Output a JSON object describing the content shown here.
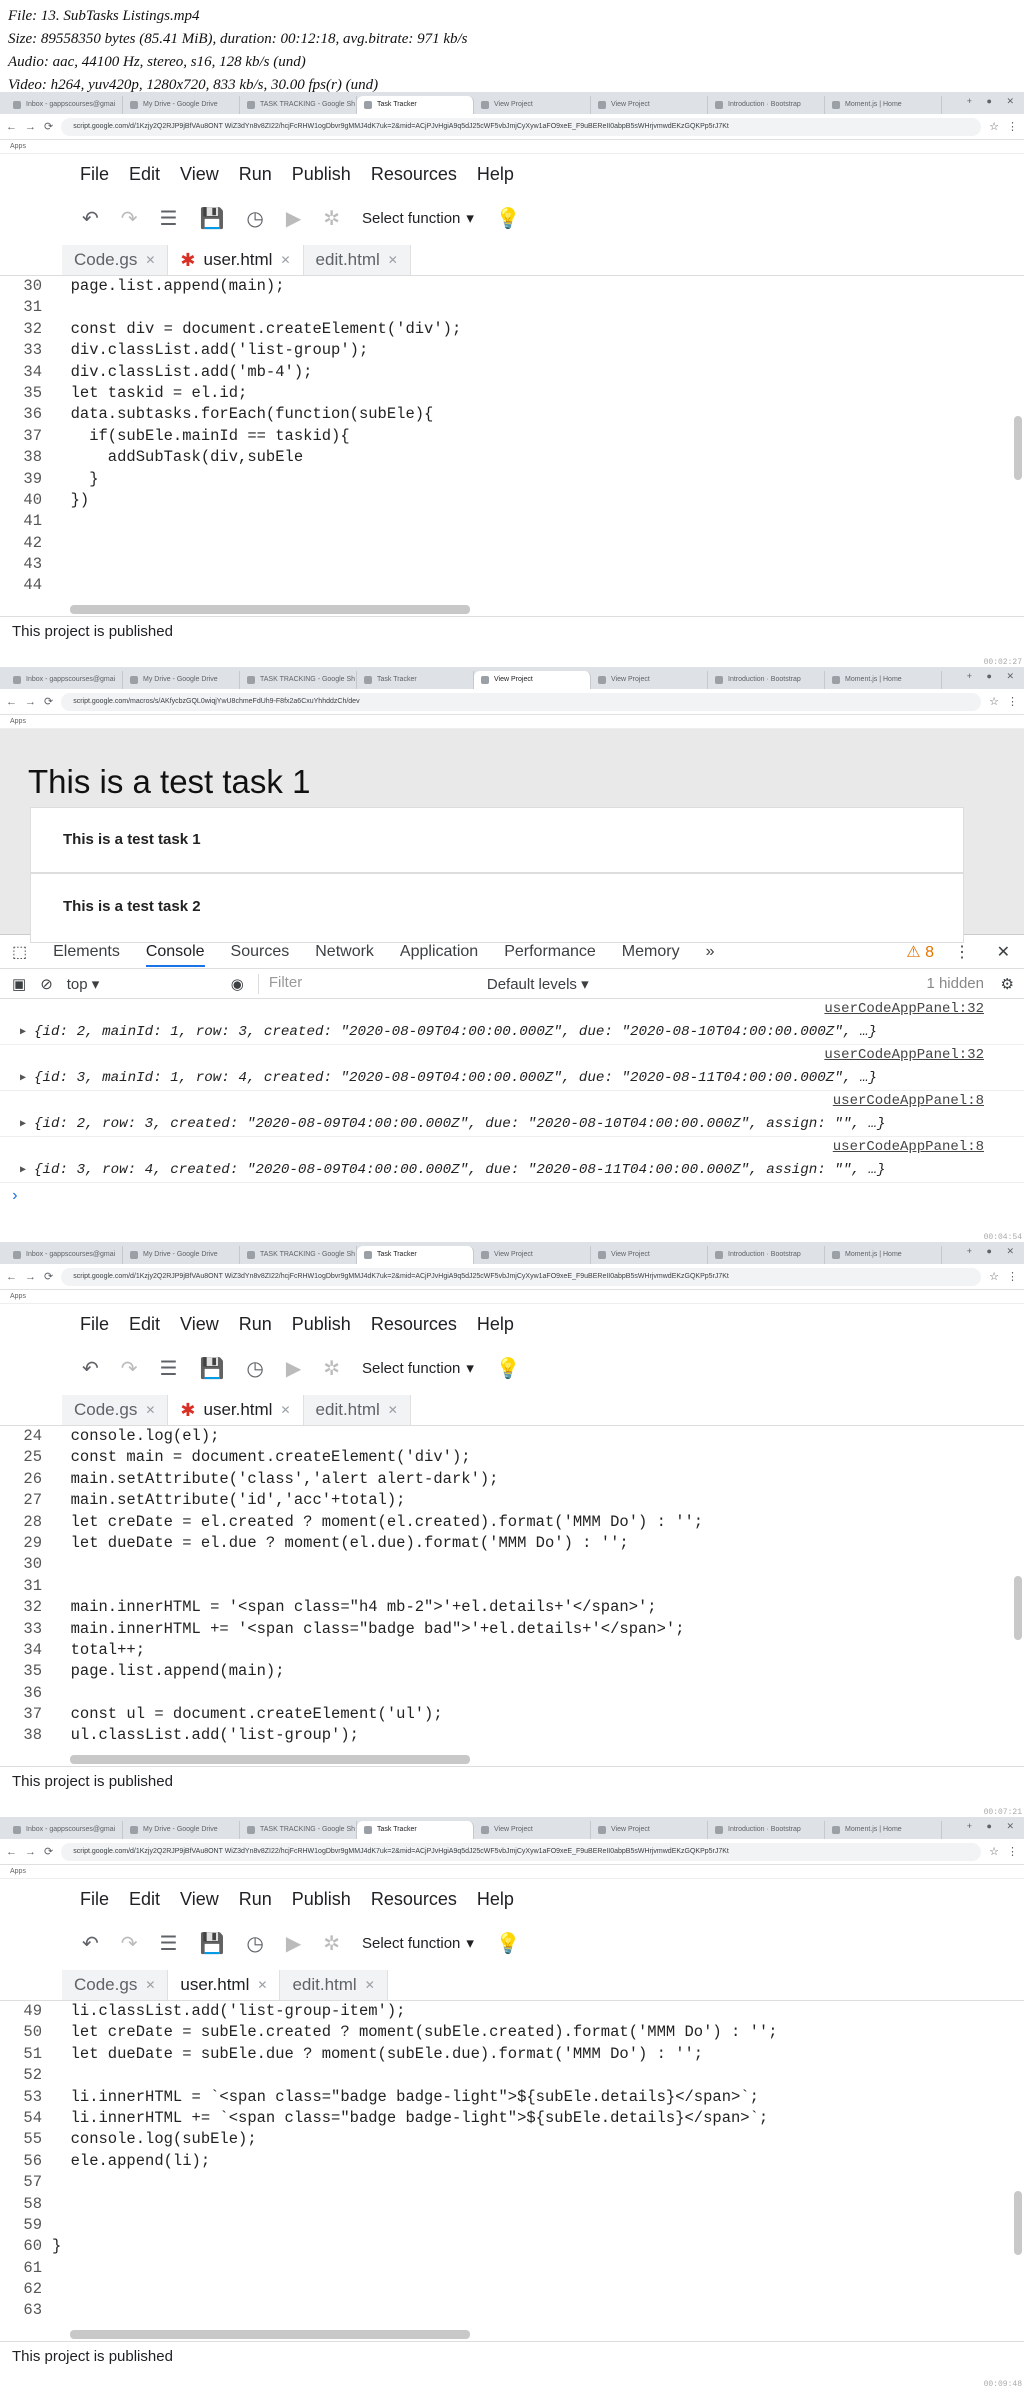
{
  "header": {
    "file": "File: 13. SubTasks Listings.mp4",
    "size": "Size: 89558350 bytes (85.41 MiB), duration: 00:12:18, avg.bitrate: 971 kb/s",
    "audio": "Audio: aac, 44100 Hz, stereo, s16, 128 kb/s (und)",
    "video": "Video: h264, yuv420p, 1280x720, 833 kb/s, 30.00 fps(r) (und)"
  },
  "browser": {
    "tabs": [
      "Inbox - gappscourses@gmai",
      "My Drive - Google Drive",
      "TASK TRACKING - Google Sh",
      "Task Tracker",
      "View Project",
      "View Project",
      "Introduction · Bootstrap",
      "Moment.js | Home"
    ],
    "url": "script.google.com/d/1Kzjy2Q2RJP9jBfVAu8ONT WiZ3dYn8v8ZI22/hcjFcRHW1ogDbvr9gMMJ4dK7uk=2&mid=ACjPJvHgiA9q5dJ25cWF5vbJmjCyXyw1aFO9xeE_F9uBEReII0abpB5sWHrjvmwdEKzGQKPp5rJ7Kt",
    "url2": "script.google.com/macros/s/AKfycbzGQL0wiqjYwU8chmeFdUh9-F8fx2a6CxuYhhddzCh/dev",
    "apps": "Apps"
  },
  "editor": {
    "menu": [
      "File",
      "Edit",
      "View",
      "Run",
      "Publish",
      "Resources",
      "Help"
    ],
    "select_function": "Select function",
    "files": [
      "Code.gs",
      "user.html",
      "edit.html"
    ],
    "status": "This project is published"
  },
  "panel1": {
    "lines": [
      {
        "n": "30",
        "t": "  page.list.append(main);"
      },
      {
        "n": "31",
        "t": ""
      },
      {
        "n": "32",
        "t": "  const div = document.createElement('div');"
      },
      {
        "n": "33",
        "t": "  div.classList.add('list-group');"
      },
      {
        "n": "34",
        "t": "  div.classList.add('mb-4');"
      },
      {
        "n": "35",
        "t": "  let taskid = el.id;"
      },
      {
        "n": "36",
        "t": "  data.subtasks.forEach(function(subEle){"
      },
      {
        "n": "37",
        "t": "    if(subEle.mainId == taskid){"
      },
      {
        "n": "38",
        "t": "      addSubTask(div,subEle"
      },
      {
        "n": "39",
        "t": "    }"
      },
      {
        "n": "40",
        "t": "  })"
      },
      {
        "n": "41",
        "t": ""
      },
      {
        "n": "42",
        "t": ""
      },
      {
        "n": "43",
        "t": ""
      },
      {
        "n": "44",
        "t": ""
      }
    ]
  },
  "panel2": {
    "title": "This is a test task 1",
    "cards": [
      "This is a test task 1",
      "This is a test task 2"
    ],
    "devtabs": [
      "Elements",
      "Console",
      "Sources",
      "Network",
      "Application",
      "Performance",
      "Memory"
    ],
    "warnings": "8",
    "context": "top",
    "filter_placeholder": "Filter",
    "levels": "Default levels",
    "hidden": "1 hidden",
    "logs": [
      {
        "src": "userCodeAppPanel:32",
        "obj": "{id: 2, mainId: 1, row: 3, created: \"2020-08-09T04:00:00.000Z\", due: \"2020-08-10T04:00:00.000Z\", …}"
      },
      {
        "src": "userCodeAppPanel:32",
        "obj": "{id: 3, mainId: 1, row: 4, created: \"2020-08-09T04:00:00.000Z\", due: \"2020-08-11T04:00:00.000Z\", …}"
      },
      {
        "src": "userCodeAppPanel:8",
        "obj": "{id: 2, row: 3, created: \"2020-08-09T04:00:00.000Z\", due: \"2020-08-10T04:00:00.000Z\", assign: \"\", …}"
      },
      {
        "src": "userCodeAppPanel:8",
        "obj": "{id: 3, row: 4, created: \"2020-08-09T04:00:00.000Z\", due: \"2020-08-11T04:00:00.000Z\", assign: \"\", …}"
      }
    ]
  },
  "panel3": {
    "lines": [
      {
        "n": "24",
        "t": "  console.log(el);"
      },
      {
        "n": "25",
        "t": "  const main = document.createElement('div');"
      },
      {
        "n": "26",
        "t": "  main.setAttribute('class','alert alert-dark');"
      },
      {
        "n": "27",
        "t": "  main.setAttribute('id','acc'+total);"
      },
      {
        "n": "28",
        "t": "  let creDate = el.created ? moment(el.created).format('MMM Do') : '';"
      },
      {
        "n": "29",
        "t": "  let dueDate = el.due ? moment(el.due).format('MMM Do') : '';"
      },
      {
        "n": "30",
        "t": ""
      },
      {
        "n": "31",
        "t": ""
      },
      {
        "n": "32",
        "t": "  main.innerHTML = '<span class=\"h4 mb-2\">'+el.details+'</span>';"
      },
      {
        "n": "33",
        "t": "  main.innerHTML += '<span class=\"badge bad\">'+el.details+'</span>';"
      },
      {
        "n": "34",
        "t": "  total++;"
      },
      {
        "n": "35",
        "t": "  page.list.append(main);"
      },
      {
        "n": "36",
        "t": ""
      },
      {
        "n": "37",
        "t": "  const ul = document.createElement('ul');"
      },
      {
        "n": "38",
        "t": "  ul.classList.add('list-group');"
      }
    ]
  },
  "panel4": {
    "lines": [
      {
        "n": "49",
        "t": "  li.classList.add('list-group-item');"
      },
      {
        "n": "50",
        "t": "  let creDate = subEle.created ? moment(subEle.created).format('MMM Do') : '';"
      },
      {
        "n": "51",
        "t": "  let dueDate = subEle.due ? moment(subEle.due).format('MMM Do') : '';"
      },
      {
        "n": "52",
        "t": ""
      },
      {
        "n": "53",
        "t": "  li.innerHTML = `<span class=\"badge badge-light\">${subEle.details}</span>`;"
      },
      {
        "n": "54",
        "t": "  li.innerHTML += `<span class=\"badge badge-light\">${subEle.details}</span>`;"
      },
      {
        "n": "55",
        "t": "  console.log(subEle);"
      },
      {
        "n": "56",
        "t": "  ele.append(li);"
      },
      {
        "n": "57",
        "t": ""
      },
      {
        "n": "58",
        "t": ""
      },
      {
        "n": "59",
        "t": ""
      },
      {
        "n": "60",
        "t": "}"
      },
      {
        "n": "61",
        "t": ""
      },
      {
        "n": "62",
        "t": ""
      },
      {
        "n": "63",
        "t": ""
      }
    ]
  },
  "watermarks": [
    "00:02:27",
    "00:04:54",
    "00:07:21",
    "00:09:48"
  ]
}
